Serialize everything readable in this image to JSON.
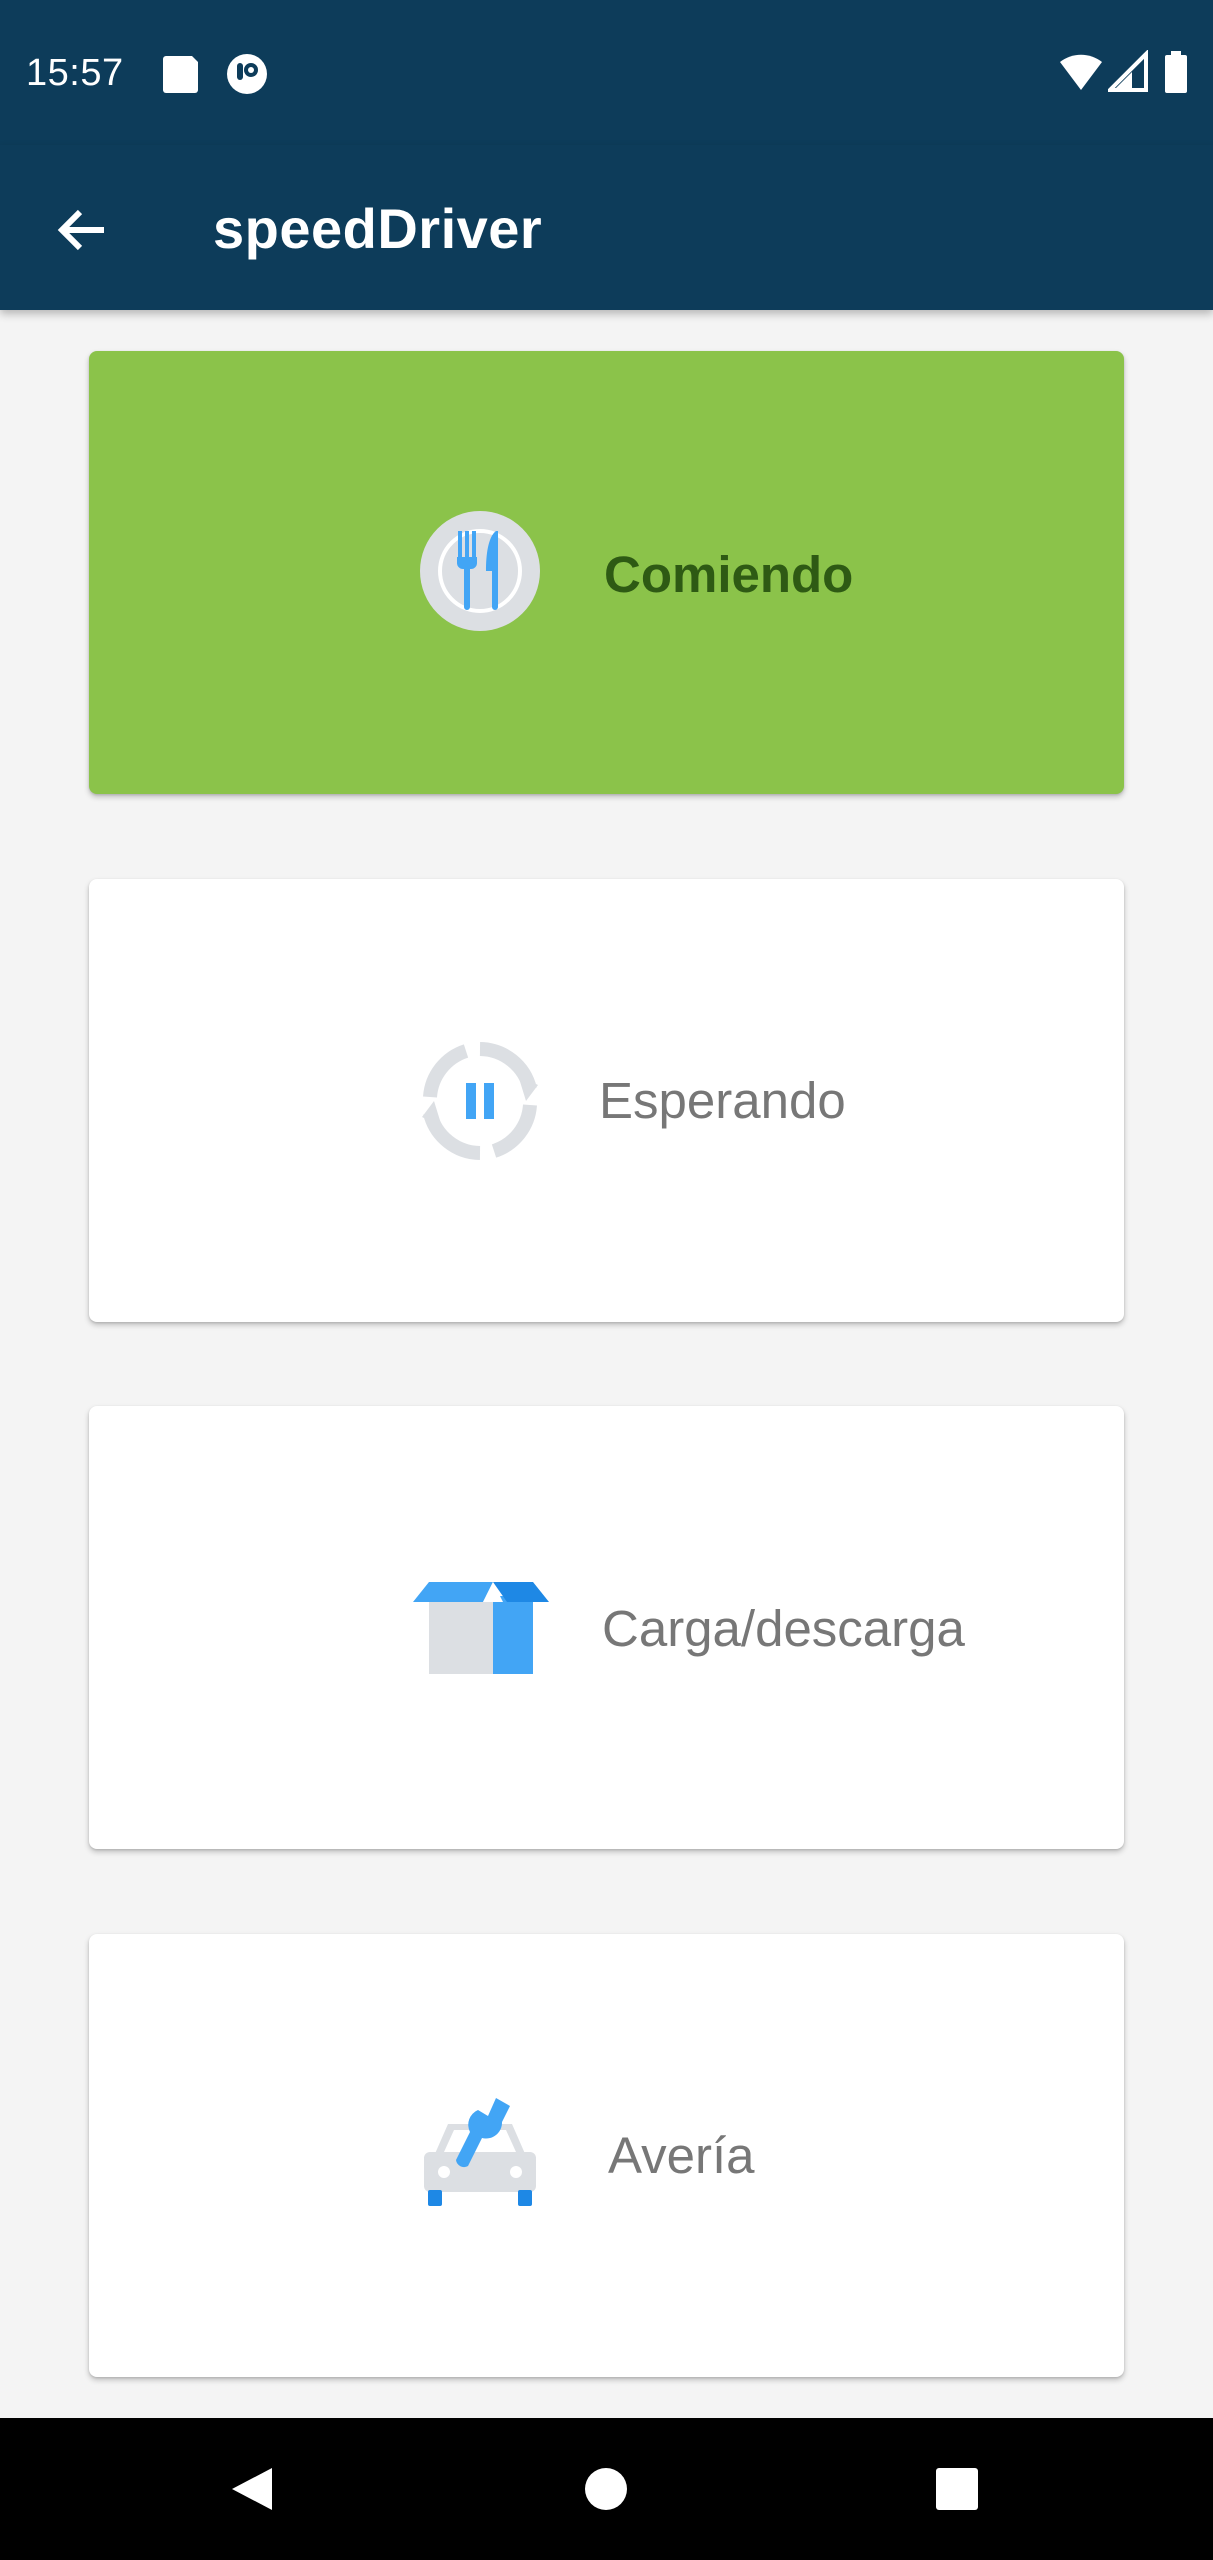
{
  "status_bar": {
    "time": "15:57",
    "left_icons": [
      "sd-card-icon",
      "notification-app-icon"
    ],
    "right_icons": [
      "wifi-icon",
      "signal-icon",
      "battery-icon"
    ]
  },
  "app_bar": {
    "back_icon": "arrow-back-icon",
    "title": "speedDriver"
  },
  "cards": [
    {
      "label": "Comiendo",
      "icon": "cutlery-plate-icon",
      "selected": true
    },
    {
      "label": "Esperando",
      "icon": "pause-refresh-icon",
      "selected": false
    },
    {
      "label": "Carga/descarga",
      "icon": "box-icon",
      "selected": false
    },
    {
      "label": "Avería",
      "icon": "car-wrench-icon",
      "selected": false
    }
  ],
  "nav_bar": {
    "buttons": [
      "back-triangle-icon",
      "home-circle-icon",
      "recents-square-icon"
    ]
  },
  "colors": {
    "primary_dark": "#0d3c5a",
    "selected_card": "#8bc34a",
    "selected_text": "#2e5a14",
    "icon_blue": "#42a5f5",
    "icon_gray": "#dcdfe3"
  }
}
